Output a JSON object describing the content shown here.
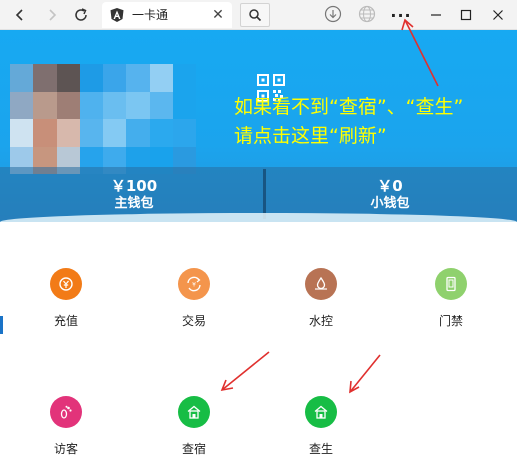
{
  "browser": {
    "tab_title": "一卡通",
    "tab_close": "✕",
    "back_icon": "back-arrow-icon",
    "forward_icon": "forward-arrow-icon",
    "reload_icon": "reload-icon",
    "more_label": "···"
  },
  "card": {
    "overlay_line1": "如果看不到“查宿”、“查生”",
    "overlay_line2": "请点击这里“刷新”",
    "main_wallet": {
      "amount": "￥100",
      "label": "主钱包"
    },
    "small_wallet": {
      "amount": "￥0",
      "label": "小钱包"
    }
  },
  "features": [
    {
      "label": "充值",
      "color": "#f27b17",
      "icon": "recharge-icon"
    },
    {
      "label": "交易",
      "color": "#f4954c",
      "icon": "transaction-icon"
    },
    {
      "label": "水控",
      "color": "#b87354",
      "icon": "water-control-icon"
    },
    {
      "label": "门禁",
      "color": "#8fd16d",
      "icon": "door-access-icon"
    },
    {
      "label": "访客",
      "color": "#e2337a",
      "icon": "visitor-icon"
    },
    {
      "label": "查宿",
      "color": "#17bd45",
      "icon": "dorm-check-icon"
    },
    {
      "label": "查生",
      "color": "#17bd45",
      "icon": "student-check-icon"
    }
  ],
  "colors": {
    "header_blue": "#1ba4ed",
    "annotation_text": "#ffff00",
    "annotation_arrow": "#e0302e"
  }
}
